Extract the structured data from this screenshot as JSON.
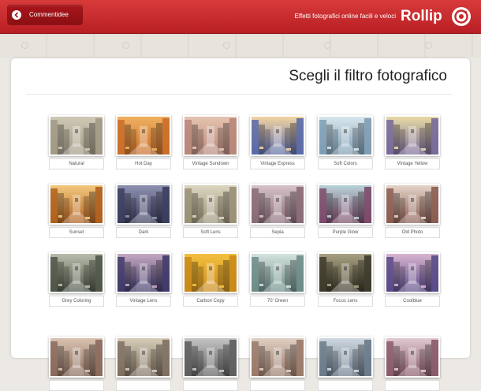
{
  "header": {
    "back_label": "Commentidee",
    "tagline": "Effetti fotografici online facili e veloci",
    "logo_text": "Rollip",
    "colors": {
      "bar": "#c8282d",
      "button": "#9b1217"
    }
  },
  "main": {
    "title": "Scegli il filtro fotografico"
  },
  "filters": [
    {
      "label": "Natural",
      "tint": "#a29a86",
      "top": "#cfc8b6"
    },
    {
      "label": "Hot Day",
      "tint": "#c96f2a",
      "top": "#f0b060"
    },
    {
      "label": "Vintage Sundown",
      "tint": "#b8877a",
      "top": "#e5c4b0"
    },
    {
      "label": "Vintage Express",
      "tint": "#5a6aa8",
      "top": "#f2d3a2"
    },
    {
      "label": "Soft Colors",
      "tint": "#7e9db4",
      "top": "#d8e6ec"
    },
    {
      "label": "Vintage Yellow",
      "tint": "#786a9a",
      "top": "#e7d9a4"
    },
    {
      "label": "Sunset",
      "tint": "#b0601e",
      "top": "#f3c87e"
    },
    {
      "label": "Dark",
      "tint": "#3b3d5e",
      "top": "#8e90b0"
    },
    {
      "label": "Soft Lens",
      "tint": "#9a9076",
      "top": "#dcd6c0"
    },
    {
      "label": "Sepia",
      "tint": "#8a6b78",
      "top": "#d6c2c8"
    },
    {
      "label": "Purple Glow",
      "tint": "#7c4a6a",
      "top": "#b7d2d8"
    },
    {
      "label": "Old Photo",
      "tint": "#8b5d52",
      "top": "#e4d3c8"
    },
    {
      "label": "Grey Coloring",
      "tint": "#4f5648",
      "top": "#b7bcaa"
    },
    {
      "label": "Vintage Lens",
      "tint": "#3f3a6a",
      "top": "#c4a8c0"
    },
    {
      "label": "Carbon Copy",
      "tint": "#c98a1a",
      "top": "#f4c040"
    },
    {
      "label": "70' Green",
      "tint": "#6d8c88",
      "top": "#d3e2dc"
    },
    {
      "label": "Focus Lens",
      "tint": "#3c3a2a",
      "top": "#a8a082"
    },
    {
      "label": "Coolblue",
      "tint": "#5a4a88",
      "top": "#d8b4d0"
    },
    {
      "label": "",
      "tint": "#8a6a5c",
      "top": "#d9c2b0"
    },
    {
      "label": "",
      "tint": "#807060",
      "top": "#d6cbb8"
    },
    {
      "label": "",
      "tint": "#5e5e5e",
      "top": "#c4c4c4"
    },
    {
      "label": "",
      "tint": "#9a7a6a",
      "top": "#e0cfc2"
    },
    {
      "label": "",
      "tint": "#6a7a8a",
      "top": "#cfd8e0"
    },
    {
      "label": "",
      "tint": "#8a5a6a",
      "top": "#e0c8d0"
    }
  ]
}
